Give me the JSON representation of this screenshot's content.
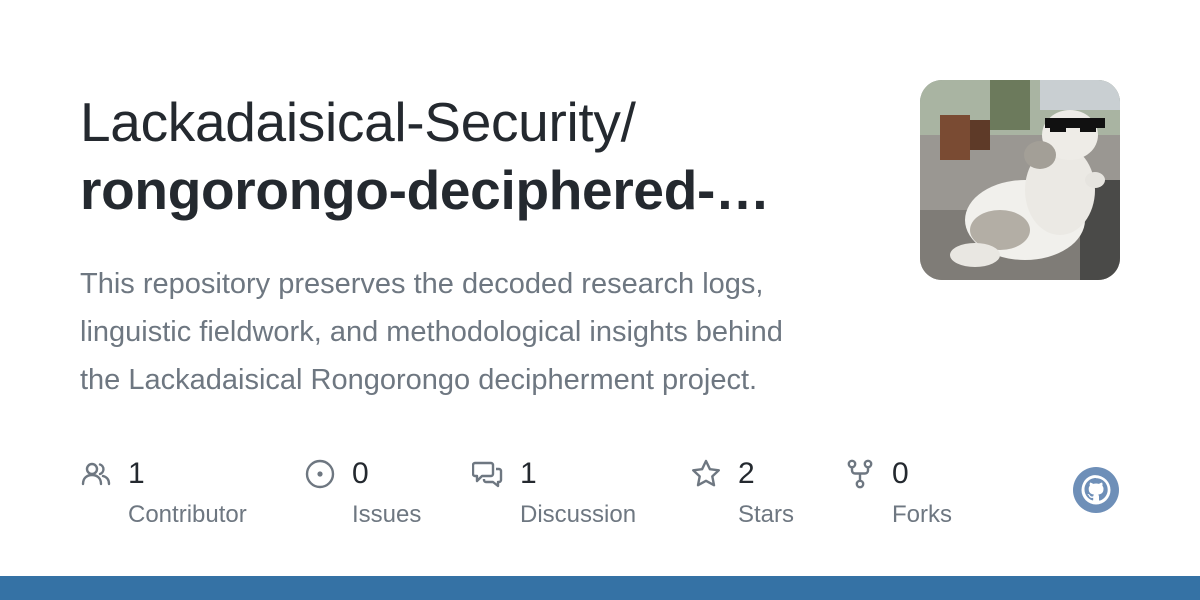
{
  "repo": {
    "owner": "Lackadaisical-Security/",
    "name": "rongorongo-deciphered-…",
    "description": "This repository preserves the decoded research logs, linguistic fieldwork, and methodological insights behind the Lackadaisical Rongorongo decipherment project."
  },
  "stats": [
    {
      "count": "1",
      "label": "Contributor",
      "icon": "people-icon"
    },
    {
      "count": "0",
      "label": "Issues",
      "icon": "issue-icon"
    },
    {
      "count": "1",
      "label": "Discussion",
      "icon": "discussion-icon"
    },
    {
      "count": "2",
      "label": "Stars",
      "icon": "star-icon"
    },
    {
      "count": "0",
      "label": "Forks",
      "icon": "fork-icon"
    }
  ],
  "colors": {
    "text": "#24292f",
    "muted": "#6e7781",
    "language_bar": "#3572a5",
    "github_logo": "#6e8fb8"
  }
}
